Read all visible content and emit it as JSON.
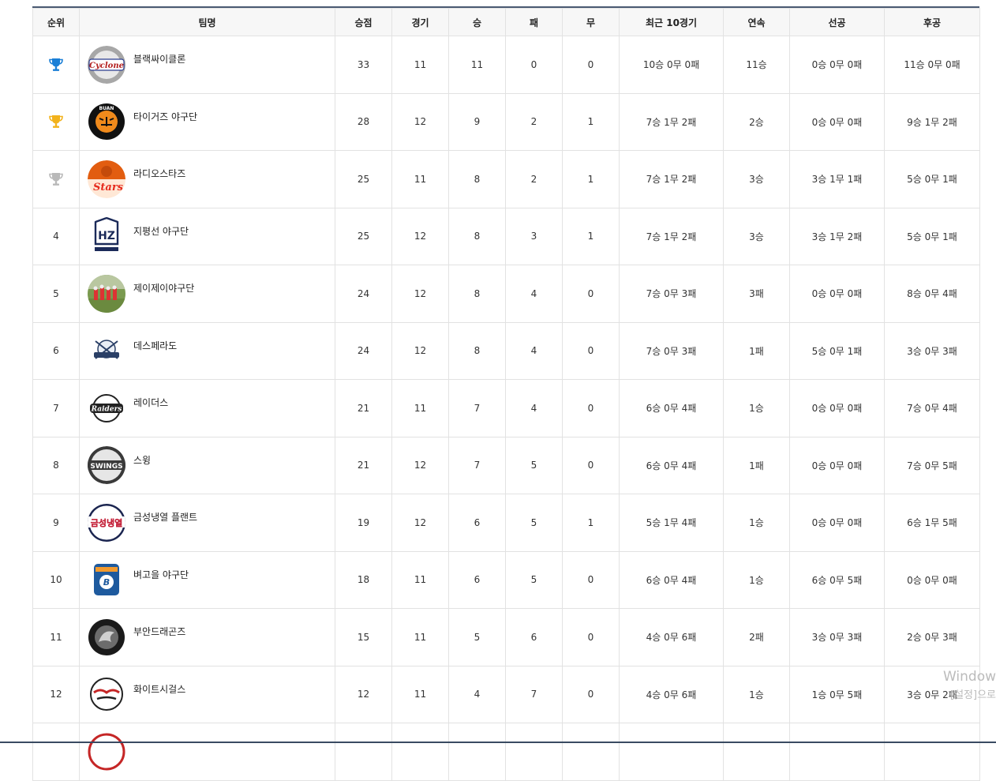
{
  "headers": [
    "순위",
    "팀명",
    "승점",
    "경기",
    "승",
    "패",
    "무",
    "최근 10경기",
    "연속",
    "선공",
    "후공"
  ],
  "rows": [
    {
      "rank": "1",
      "trophy": "gold-blue",
      "logo": "cyclone",
      "logo_text": "Cyclone",
      "name": "블랙싸이클론",
      "pts": "33",
      "g": "11",
      "w": "11",
      "l": "0",
      "d": "0",
      "last10": "10승 0무 0패",
      "streak": "11승",
      "first": "0승 0무 0패",
      "second": "11승 0무 0패"
    },
    {
      "rank": "2",
      "trophy": "gold",
      "logo": "tigers",
      "logo_text": "BUAN",
      "name": "타이거즈 야구단",
      "pts": "28",
      "g": "12",
      "w": "9",
      "l": "2",
      "d": "1",
      "last10": "7승 1무 2패",
      "streak": "2승",
      "first": "0승 0무 0패",
      "second": "9승 1무 2패"
    },
    {
      "rank": "3",
      "trophy": "silver",
      "logo": "stars",
      "logo_text": "Stars",
      "name": "라디오스타즈",
      "pts": "25",
      "g": "11",
      "w": "8",
      "l": "2",
      "d": "1",
      "last10": "7승 1무 2패",
      "streak": "3승",
      "first": "3승 1무 1패",
      "second": "5승 0무 1패"
    },
    {
      "rank": "4",
      "trophy": "",
      "logo": "hz",
      "logo_text": "HZ",
      "name": "지평선 야구단",
      "pts": "25",
      "g": "12",
      "w": "8",
      "l": "3",
      "d": "1",
      "last10": "7승 1무 2패",
      "streak": "3승",
      "first": "3승 1무 2패",
      "second": "5승 0무 1패"
    },
    {
      "rank": "5",
      "trophy": "",
      "logo": "photo",
      "logo_text": "",
      "name": "제이제이야구단",
      "pts": "24",
      "g": "12",
      "w": "8",
      "l": "4",
      "d": "0",
      "last10": "7승 0무 3패",
      "streak": "3패",
      "first": "0승 0무 0패",
      "second": "8승 0무 4패"
    },
    {
      "rank": "6",
      "trophy": "",
      "logo": "desperado",
      "logo_text": "",
      "name": "데스페라도",
      "pts": "24",
      "g": "12",
      "w": "8",
      "l": "4",
      "d": "0",
      "last10": "7승 0무 3패",
      "streak": "1패",
      "first": "5승 0무 1패",
      "second": "3승 0무 3패"
    },
    {
      "rank": "7",
      "trophy": "",
      "logo": "raiders",
      "logo_text": "Raiders",
      "name": "레이더스",
      "pts": "21",
      "g": "11",
      "w": "7",
      "l": "4",
      "d": "0",
      "last10": "6승 0무 4패",
      "streak": "1승",
      "first": "0승 0무 0패",
      "second": "7승 0무 4패"
    },
    {
      "rank": "8",
      "trophy": "",
      "logo": "swings",
      "logo_text": "SWINGS",
      "name": "스윙",
      "pts": "21",
      "g": "12",
      "w": "7",
      "l": "5",
      "d": "0",
      "last10": "6승 0무 4패",
      "streak": "1패",
      "first": "0승 0무 0패",
      "second": "7승 0무 5패"
    },
    {
      "rank": "9",
      "trophy": "",
      "logo": "plant",
      "logo_text": "금성냉열",
      "name": "금성냉열 플랜트",
      "pts": "19",
      "g": "12",
      "w": "6",
      "l": "5",
      "d": "1",
      "last10": "5승 1무 4패",
      "streak": "1승",
      "first": "0승 0무 0패",
      "second": "6승 1무 5패"
    },
    {
      "rank": "10",
      "trophy": "",
      "logo": "byeogol",
      "logo_text": "B",
      "name": "벼고을 야구단",
      "pts": "18",
      "g": "11",
      "w": "6",
      "l": "5",
      "d": "0",
      "last10": "6승 0무 4패",
      "streak": "1승",
      "first": "6승 0무 5패",
      "second": "0승 0무 0패"
    },
    {
      "rank": "11",
      "trophy": "",
      "logo": "dragons",
      "logo_text": "",
      "name": "부안드래곤즈",
      "pts": "15",
      "g": "11",
      "w": "5",
      "l": "6",
      "d": "0",
      "last10": "4승 0무 6패",
      "streak": "2패",
      "first": "3승 0무 3패",
      "second": "2승 0무 3패"
    },
    {
      "rank": "12",
      "trophy": "",
      "logo": "seagulls",
      "logo_text": "",
      "name": "화이트시걸스",
      "pts": "12",
      "g": "11",
      "w": "4",
      "l": "7",
      "d": "0",
      "last10": "4승 0무 6패",
      "streak": "1승",
      "first": "1승 0무 5패",
      "second": "3승 0무 2패"
    }
  ],
  "watermark": {
    "line1": "Window",
    "line2": "[설정]으로"
  },
  "colors": {
    "header_bg": "#f7f7f7",
    "border": "#e2e2e2",
    "top_border": "#4a5a72",
    "trophy_blue": "#1a7fd6",
    "trophy_gold": "#f2b21c",
    "trophy_silver": "#b9b9b9"
  }
}
